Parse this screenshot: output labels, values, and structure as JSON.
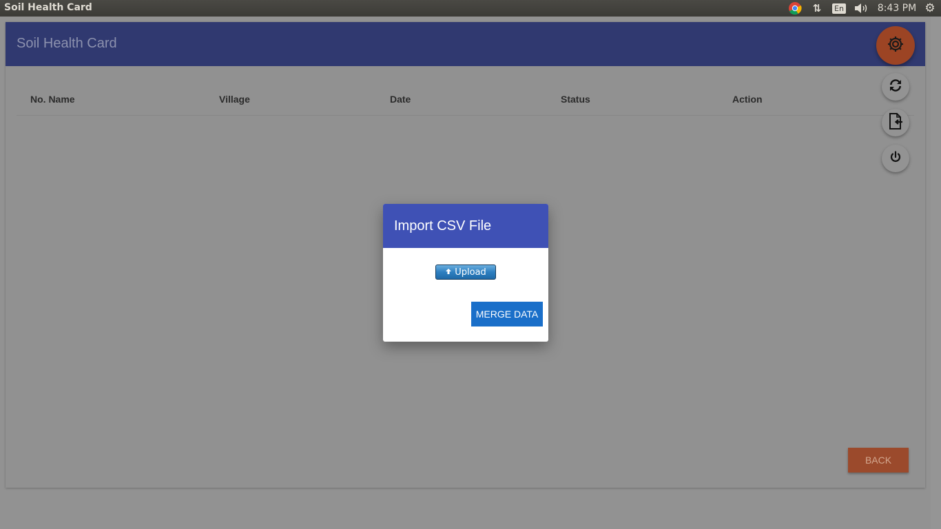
{
  "os_panel": {
    "window_title": "Soil Health Card",
    "keyboard_layout": "En",
    "clock": "8:43 PM",
    "icons": [
      "chrome-icon",
      "network-arrows-icon",
      "keyboard-layout-icon",
      "volume-icon",
      "settings-gear-icon"
    ]
  },
  "app": {
    "title": "Soil Health Card",
    "table": {
      "columns": [
        "No. Name",
        "Village",
        "Date",
        "Status",
        "Action"
      ],
      "rows": []
    },
    "back_label": "BACK",
    "fabs": [
      "gear-icon",
      "sync-icon",
      "file-import-icon",
      "power-icon"
    ]
  },
  "dialog": {
    "title": "Import CSV File",
    "upload_label": "Upload",
    "merge_label": "MERGE DATA"
  },
  "colors": {
    "app_header": "#303970",
    "dialog_header": "#3f51b5",
    "merge_button": "#1a6fc9",
    "fab_main": "#9c4424",
    "back_button": "#9b4a2c",
    "overlay_background": "#929292"
  }
}
